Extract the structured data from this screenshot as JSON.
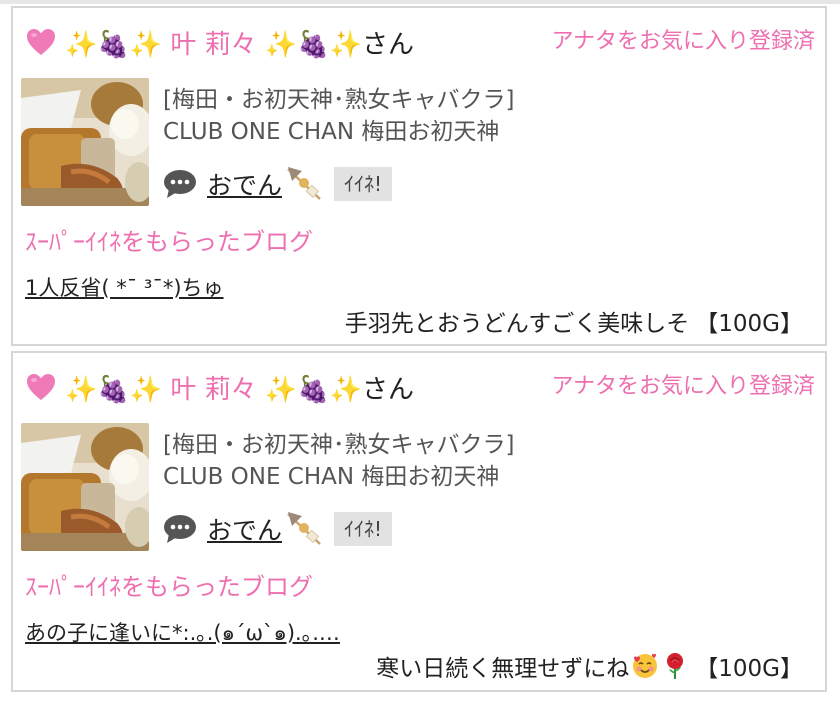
{
  "accent_color": "#ee6fb0",
  "cards": [
    {
      "user_name": "✨🍇✨ 叶 莉々 ✨🍇✨",
      "honorific": "さん",
      "fav_status": "アナタをお気に入り登録済",
      "shop_area": "[梅田・お初天神･熟女キャバクラ]",
      "shop_name": "CLUB ONE CHAN 梅田お初天神",
      "post_title": "おでん",
      "like_label": "ｲｲﾈ!",
      "super_label": "ｽｰﾊﾟｰｲｲﾈをもらったブログ",
      "blog_title": "1人反省( *¯ ³¯*)ちゅ",
      "message": "手羽先とおうどんすごく美味しそ",
      "message_emojis": [],
      "reward": "【100G】"
    },
    {
      "user_name": "✨🍇✨ 叶 莉々 ✨🍇✨",
      "honorific": "さん",
      "fav_status": "アナタをお気に入り登録済",
      "shop_area": "[梅田・お初天神･熟女キャバクラ]",
      "shop_name": "CLUB ONE CHAN 梅田お初天神",
      "post_title": "おでん",
      "like_label": "ｲｲﾈ!",
      "super_label": "ｽｰﾊﾟｰｲｲﾈをもらったブログ",
      "blog_title": "あの子に逢いに*:.｡.(๑´ω`๑).｡.…",
      "message": "寒い日続く無理せずにね",
      "message_emojis": [
        "smiling-face-with-hearts",
        "rose"
      ],
      "reward": "【100G】"
    }
  ]
}
